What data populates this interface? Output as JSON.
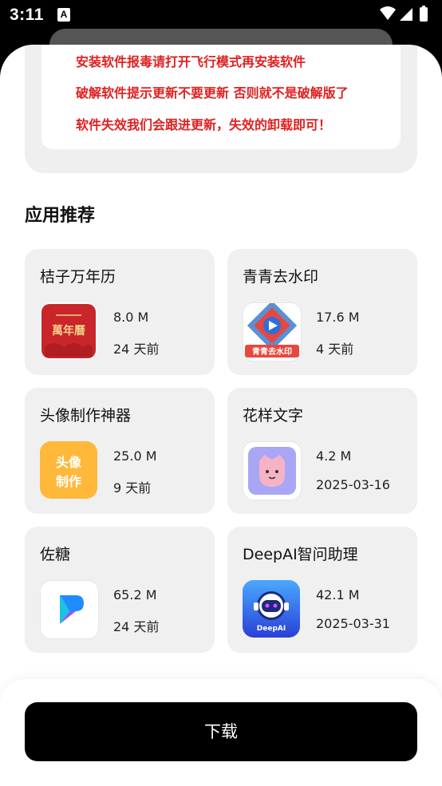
{
  "status_bar": {
    "time": "3:11",
    "notification_glyph": "A"
  },
  "notice": {
    "lines": [
      "安装软件报毒请打开飞行模式再安装软件",
      "破解软件提示更新不要更新 否则就不是破解版了",
      "软件失效我们会跟进更新，失效的卸载即可！"
    ],
    "color": "#e02020"
  },
  "section": {
    "title": "应用推荐"
  },
  "apps": [
    {
      "name": "桔子万年历",
      "size": "8.0 M",
      "date": "24 天前",
      "icon": "wannianli-icon",
      "icon_text": "萬年曆"
    },
    {
      "name": "青青去水印",
      "size": "17.6 M",
      "date": "4 天前",
      "icon": "qingqing-icon",
      "icon_text": "青青去水印"
    },
    {
      "name": "头像制作神器",
      "size": "25.0 M",
      "date": "9 天前",
      "icon": "touxiang-icon",
      "icon_text": "头像制作"
    },
    {
      "name": "花样文字",
      "size": "4.2 M",
      "date": "2025-03-16",
      "icon": "huayang-icon",
      "icon_text": ""
    },
    {
      "name": "佐糖",
      "size": "65.2 M",
      "date": "24 天前",
      "icon": "zuotang-icon",
      "icon_text": ""
    },
    {
      "name": "DeepAI智问助理",
      "size": "42.1 M",
      "date": "2025-03-31",
      "icon": "deepai-icon",
      "icon_text": "DeepAI"
    }
  ],
  "footer": {
    "download_label": "下载"
  }
}
